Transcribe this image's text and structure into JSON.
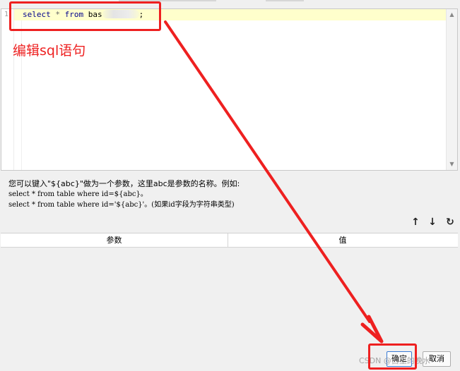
{
  "editor": {
    "line_number": "1",
    "sql": {
      "kw_select": "select",
      "star": "*",
      "kw_from": "from",
      "table_visible": "bas",
      "semicolon": ";"
    }
  },
  "annotation": {
    "label": "编辑sql语句",
    "color": "#ee2020"
  },
  "help": {
    "line1": "您可以键入\"${abc}\"做为一个参数，这里abc是参数的名称。例如:",
    "line2": "select * from table where id=${abc}。",
    "line3": "select * from table where id='${abc}'。(如果id字段为字符串类型)"
  },
  "toolbar": {
    "up_icon": "↑",
    "down_icon": "↓",
    "refresh_icon": "↻"
  },
  "grid": {
    "columns": [
      "参数",
      "值"
    ]
  },
  "buttons": {
    "ok": "确定",
    "cancel": "取消"
  },
  "watermark": "CSDN @白里的晚水"
}
